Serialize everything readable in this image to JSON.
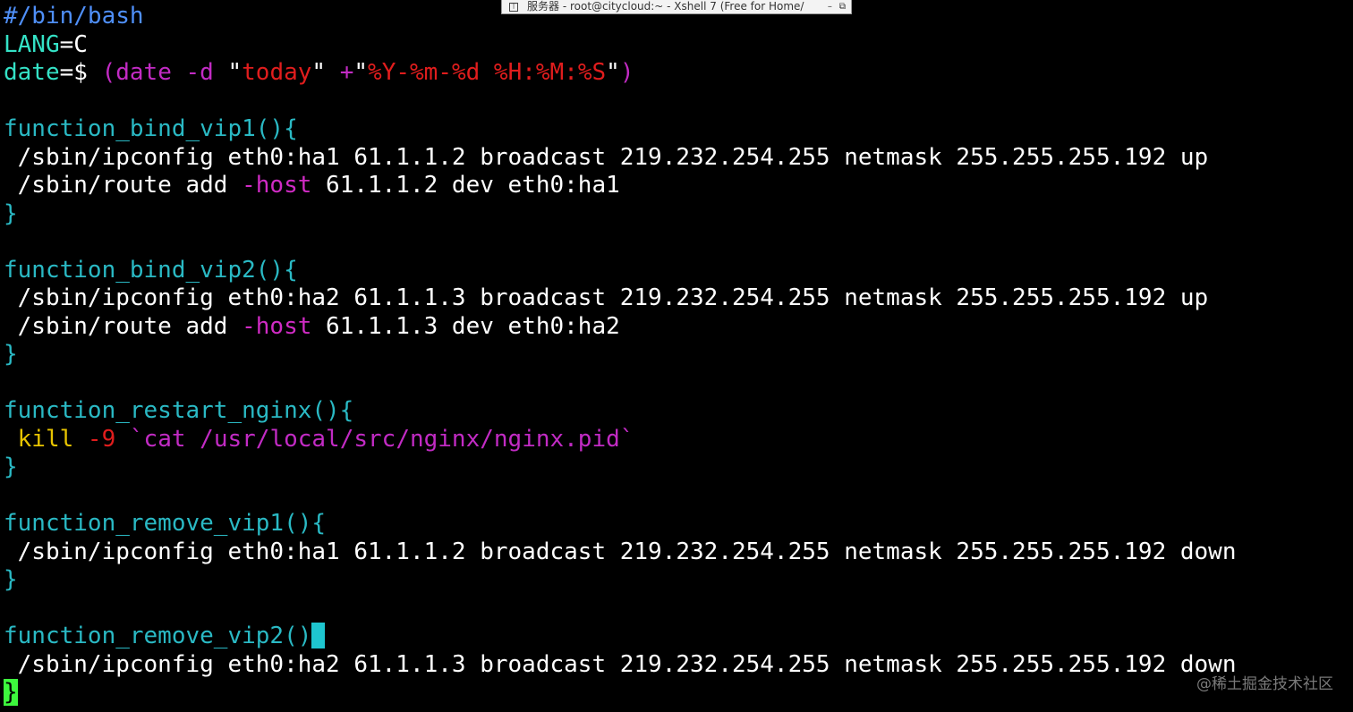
{
  "window": {
    "title": "服务器 - root@citycloud:~ - Xshell 7 (Free for Home/",
    "pin_icon": "pin-icon",
    "minimize_glyph": "–",
    "restore_glyph": "⧉"
  },
  "colors": {
    "background": "#000000",
    "default_text": "#ffffff",
    "comment": "#4f8ff8",
    "variable": "#34e2c6",
    "function": "#2ab9c4",
    "brace": "#2ab9c4",
    "option": "#d02bc4",
    "string": "#e01d1d",
    "subshell": "#c22bc4",
    "keyword": "#e8c400",
    "cursor_cyan": "#1ec6d0",
    "cursor_green": "#3df73d"
  },
  "terminal": {
    "lines": [
      [
        {
          "t": "#/bin/bash",
          "c": "#4f8ff8"
        }
      ],
      [
        {
          "t": "LANG",
          "c": "#34e2c6"
        },
        {
          "t": "=C",
          "c": "#ffffff"
        }
      ],
      [
        {
          "t": "date",
          "c": "#34e2c6"
        },
        {
          "t": "=$ ",
          "c": "#ffffff"
        },
        {
          "t": "(date -d ",
          "c": "#c22bc4"
        },
        {
          "t": "\"",
          "c": "#ffffff"
        },
        {
          "t": "today",
          "c": "#e01d1d"
        },
        {
          "t": "\" ",
          "c": "#ffffff"
        },
        {
          "t": "+",
          "c": "#c22bc4"
        },
        {
          "t": "\"",
          "c": "#ffffff"
        },
        {
          "t": "%Y-%m-%d %H:%M:%S",
          "c": "#e01d1d"
        },
        {
          "t": "\"",
          "c": "#ffffff"
        },
        {
          "t": ")",
          "c": "#c22bc4"
        }
      ],
      [],
      [
        {
          "t": "function_bind_vip1(){",
          "c": "#2ab9c4"
        }
      ],
      [
        {
          "t": " /sbin/ipconfig eth0:ha1 61.1.1.2 broadcast 219.232.254.255 netmask 255.255.255.192 up",
          "c": "#ffffff"
        }
      ],
      [
        {
          "t": " /sbin/route add ",
          "c": "#ffffff"
        },
        {
          "t": "-host",
          "c": "#d02bc4"
        },
        {
          "t": " 61.1.1.2 dev eth0:ha1",
          "c": "#ffffff"
        }
      ],
      [
        {
          "t": "}",
          "c": "#2ab9c4"
        }
      ],
      [],
      [
        {
          "t": "function_bind_vip2(){",
          "c": "#2ab9c4"
        }
      ],
      [
        {
          "t": " /sbin/ipconfig eth0:ha2 61.1.1.3 broadcast 219.232.254.255 netmask 255.255.255.192 up",
          "c": "#ffffff"
        }
      ],
      [
        {
          "t": " /sbin/route add ",
          "c": "#ffffff"
        },
        {
          "t": "-host",
          "c": "#d02bc4"
        },
        {
          "t": " 61.1.1.3 dev eth0:ha2",
          "c": "#ffffff"
        }
      ],
      [
        {
          "t": "}",
          "c": "#2ab9c4"
        }
      ],
      [],
      [
        {
          "t": "function_restart_nginx(){",
          "c": "#2ab9c4"
        }
      ],
      [
        {
          "t": " kill ",
          "c": "#e8c400"
        },
        {
          "t": "-9",
          "c": "#e01d1d"
        },
        {
          "t": " `",
          "c": "#c22bc4"
        },
        {
          "t": "cat ",
          "c": "#c22bc4"
        },
        {
          "t": "/usr/local/src/nginx/nginx.pid",
          "c": "#c22bc4"
        },
        {
          "t": "`",
          "c": "#c22bc4"
        }
      ],
      [
        {
          "t": "}",
          "c": "#2ab9c4"
        }
      ],
      [],
      [
        {
          "t": "function_remove_vip1(){",
          "c": "#2ab9c4"
        }
      ],
      [
        {
          "t": " /sbin/ipconfig eth0:ha1 61.1.1.2 broadcast 219.232.254.255 netmask 255.255.255.192 down",
          "c": "#ffffff"
        }
      ],
      [
        {
          "t": "}",
          "c": "#2ab9c4"
        }
      ],
      [],
      [
        {
          "t": "function_remove_vip2()",
          "c": "#2ab9c4"
        },
        {
          "cursor": true,
          "bg": "#1ec6d0",
          "t": ""
        }
      ],
      [
        {
          "t": " /sbin/ipconfig eth0:ha2 61.1.1.3 broadcast 219.232.254.255 netmask 255.255.255.192 down",
          "c": "#ffffff"
        }
      ],
      [
        {
          "t": "}",
          "c": "#000000",
          "bg": "#3df73d"
        }
      ]
    ]
  },
  "watermark": "@稀土掘金技术社区"
}
